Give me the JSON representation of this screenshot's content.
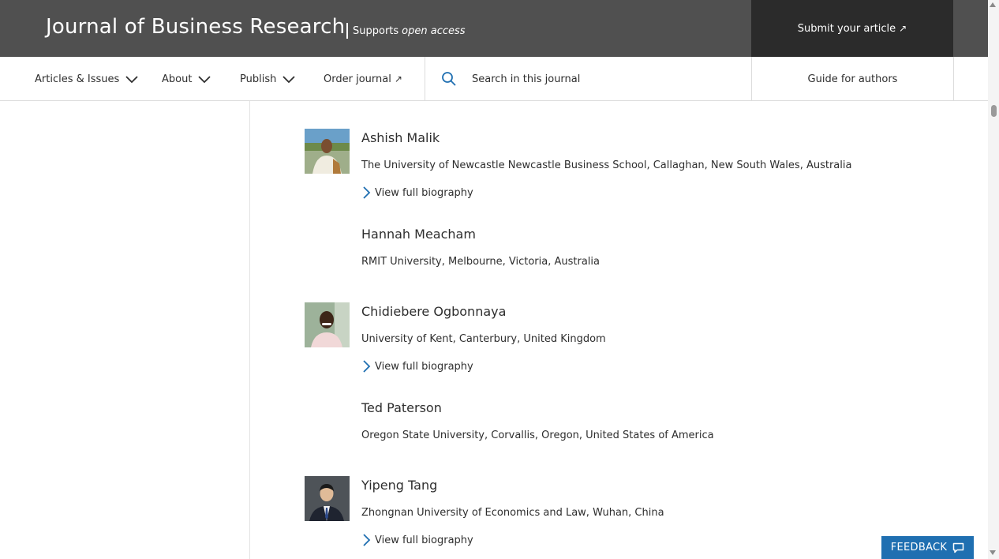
{
  "header": {
    "journal_title": "Journal of Business Research",
    "supports_prefix": "Supports",
    "supports_em": "open access",
    "submit_label": "Submit your article",
    "submit_arrow": "↗"
  },
  "nav": {
    "articles_label": "Articles & Issues",
    "about_label": "About",
    "publish_label": "Publish",
    "order_label": "Order journal",
    "order_arrow": "↗",
    "search_placeholder": "Search in this journal",
    "guide_label": "Guide for authors"
  },
  "members": [
    {
      "name": "Ashish Malik",
      "affiliation": "The University of Newcastle Newcastle Business School, Callaghan, New South Wales, Australia",
      "bio_label": "View full biography"
    },
    {
      "name": "Hannah Meacham",
      "affiliation": "RMIT University, Melbourne, Victoria, Australia"
    },
    {
      "name": "Chidiebere Ogbonnaya",
      "affiliation": "University of Kent, Canterbury, United Kingdom",
      "bio_label": "View full biography"
    },
    {
      "name": "Ted Paterson",
      "affiliation": "Oregon State University, Corvallis, Oregon, United States of America"
    },
    {
      "name": "Yipeng Tang",
      "affiliation": "Zhongnan University of Economics and Law, Wuhan, China",
      "bio_label": "View full biography"
    }
  ],
  "feedback": {
    "label": "FEEDBACK"
  },
  "colors": {
    "header_bg": "#505050",
    "submit_bg": "#2b2b2b",
    "link_blue": "#1f6fb1",
    "feedback_bg": "#1f6fb1"
  }
}
